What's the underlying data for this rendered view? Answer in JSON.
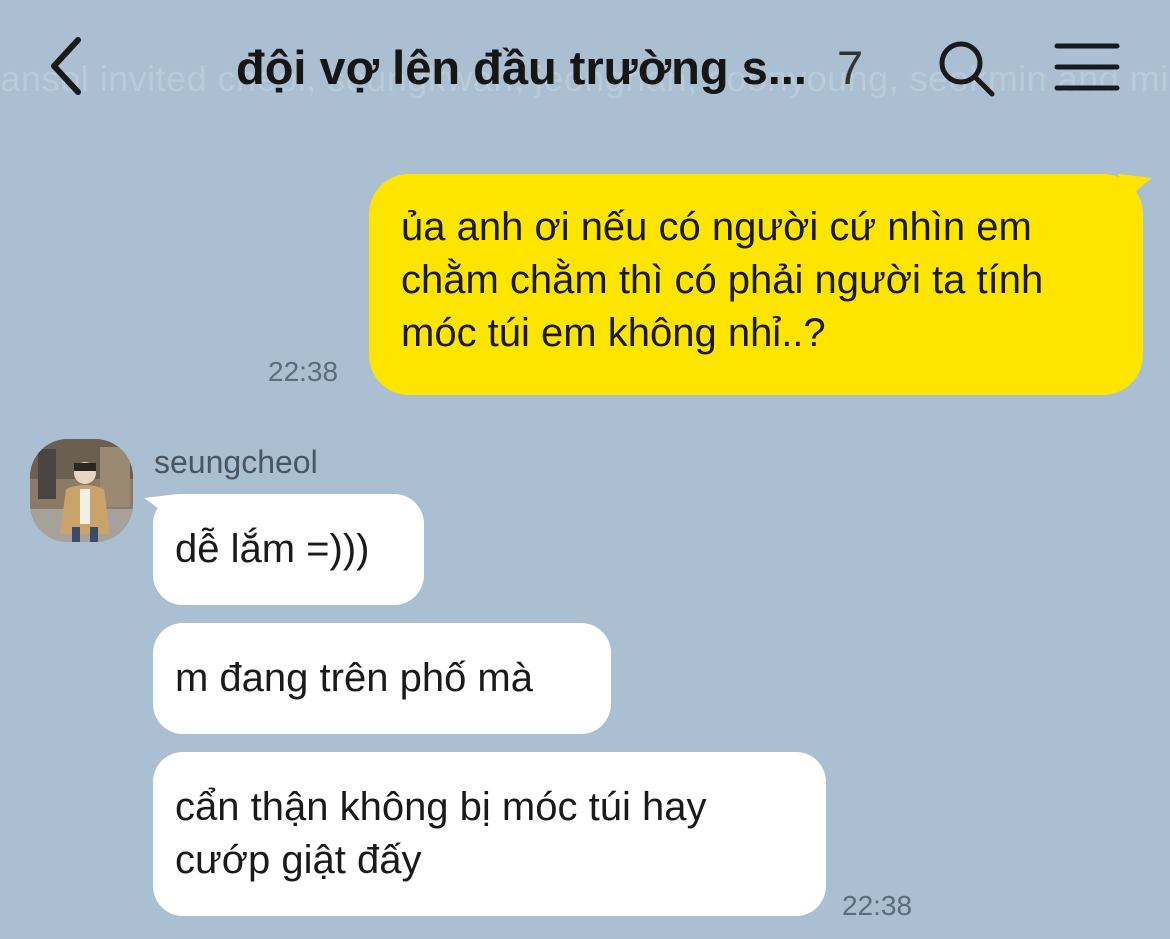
{
  "header": {
    "title": "đội vợ lên đầu trường s...",
    "member_count": "7",
    "background_notice": "hansol invited cheol, seungkwan, jeonghan, soonyoung, seokmin and mingyu"
  },
  "messages": [
    {
      "direction": "outgoing",
      "text": "ủa anh ơi nếu có người cứ nhìn em chằm chằm thì có phải người ta tính móc túi em không nhỉ..?",
      "time": "22:38"
    },
    {
      "direction": "incoming",
      "sender": "seungcheol",
      "bubbles": [
        "dễ lắm =)))",
        "m đang trên phố mà",
        "cẩn thận không bị móc túi hay cướp giật đấy"
      ],
      "time": "22:38"
    }
  ],
  "colors": {
    "background": "#aabfd2",
    "outgoing_bubble": "#fee500",
    "incoming_bubble": "#ffffff"
  },
  "icons": {
    "back": "chevron-left-icon",
    "search": "search-icon",
    "menu": "hamburger-menu-icon"
  }
}
